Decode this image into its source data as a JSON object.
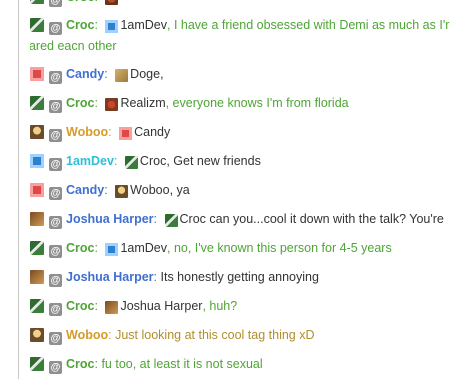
{
  "colors": {
    "croc": "#4ea536",
    "candy": "#3f6fd1",
    "woboo": "#d79b28",
    "dev": "#2bc1d7",
    "joshua": "#3f6fd1",
    "tag_bg": "#8f8f8f"
  },
  "messages": [
    {
      "avatar_icon": "croc-avatar-icon",
      "tag": "@",
      "user": "Croc",
      "mention": "1amDev",
      "text": ", I have a friend obsessed with Demi as much as I'r",
      "text2": "We dared eacn other",
      "style": "green"
    },
    {
      "avatar_icon": "candy-avatar-icon",
      "tag": "@",
      "user": "Candy",
      "mention": "Doge",
      "text": ",",
      "style": "black"
    },
    {
      "avatar_icon": "croc-avatar-icon",
      "tag": "@",
      "user": "Croc",
      "mention": "Realizm",
      "text": ", everyone knows I'm from florida",
      "style": "green"
    },
    {
      "avatar_icon": "woboo-avatar-icon",
      "tag": "@",
      "user": "Woboo",
      "mention": "Candy",
      "text": "",
      "style": "black"
    },
    {
      "avatar_icon": "dev-avatar-icon",
      "tag": "@",
      "user": "1amDev",
      "mention": "Croc",
      "text": ", Get new friends",
      "style": "black"
    },
    {
      "avatar_icon": "candy-avatar-icon",
      "tag": "@",
      "user": "Candy",
      "mention": "Woboo",
      "text": ", ya",
      "style": "black"
    },
    {
      "avatar_icon": "joshua-avatar-icon",
      "tag": "@",
      "user": "Joshua Harper",
      "mention": "Croc",
      "text": " can you...cool it down with the talk? You're",
      "style": "black"
    },
    {
      "avatar_icon": "croc-avatar-icon",
      "tag": "@",
      "user": "Croc",
      "mention": "1amDev",
      "text": ", no, I've known this person for 4-5 years",
      "style": "green"
    },
    {
      "avatar_icon": "joshua-avatar-icon",
      "tag": "@",
      "user": "Joshua Harper",
      "mention": "",
      "text": "Its honestly getting annoying",
      "style": "black"
    },
    {
      "avatar_icon": "croc-avatar-icon",
      "tag": "@",
      "user": "Croc",
      "mention": "Joshua Harper",
      "text": ", huh?",
      "style": "green"
    },
    {
      "avatar_icon": "woboo-avatar-icon",
      "tag": "@",
      "user": "Woboo",
      "mention": "",
      "text": "Just looking at this cool tag thing xD",
      "style": "gold"
    },
    {
      "avatar_icon": "croc-avatar-icon",
      "tag": "@",
      "user": "Croc",
      "mention": "",
      "text": "fu too, at least it is not sexual",
      "style": "green"
    }
  ]
}
